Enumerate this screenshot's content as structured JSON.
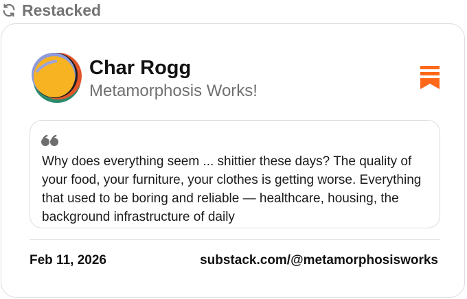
{
  "header": {
    "restacked_label": "Restacked",
    "restack_icon": "refresh-cycle-icon"
  },
  "card": {
    "author": {
      "name": "Char Rogg",
      "publication": "Metamorphosis Works!",
      "avatar_icon": "avatar-abstract-circles"
    },
    "bookmark_icon": "bookmark-icon",
    "quote": {
      "icon": "quote-icon",
      "text": "Why does everything seem ... shittier these days? The quality of your food, your furniture, your clothes is getting worse. Everything that used to be boring and reliable — healthcare, housing, the background infrastructure of daily"
    },
    "footer": {
      "date": "Feb 11, 2026",
      "url": "substack.com/@metamorphosisworks"
    }
  },
  "colors": {
    "accent": "#ff6719",
    "muted": "#747474",
    "border": "#dcdcdc"
  }
}
